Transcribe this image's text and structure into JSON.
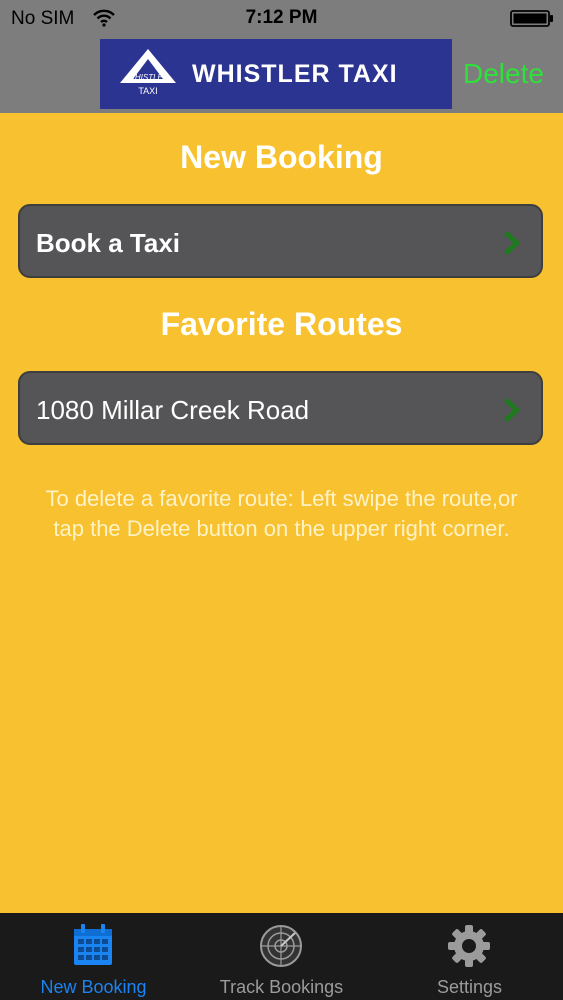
{
  "status_bar": {
    "carrier": "No SIM",
    "time": "7:12 PM"
  },
  "header": {
    "logo_mark_top": "WHISTLER",
    "logo_mark_bottom": "TAXI",
    "logo_text": "WHISTLER TAXI",
    "delete_label": "Delete"
  },
  "main": {
    "new_booking_title": "New Booking",
    "book_taxi_label": "Book a Taxi",
    "favorites_title": "Favorite Routes",
    "favorite_routes": [
      "1080 Millar Creek Road"
    ],
    "hint": "To delete a favorite route: Left swipe the route,or tap the Delete button on the upper right corner."
  },
  "tabs": [
    {
      "label": "New Booking",
      "icon": "calendar-icon",
      "active": true
    },
    {
      "label": "Track Bookings",
      "icon": "radar-icon",
      "active": false
    },
    {
      "label": "Settings",
      "icon": "gear-icon",
      "active": false
    }
  ],
  "colors": {
    "background": "#f8c12f",
    "topbar": "#7d7d7d",
    "logo_bg": "#2c3491",
    "delete": "#2fe03a",
    "row_bg": "#555456",
    "chevron": "#1f7a1f",
    "tab_active": "#1a84f2",
    "tab_inactive": "#9b9b9b"
  }
}
